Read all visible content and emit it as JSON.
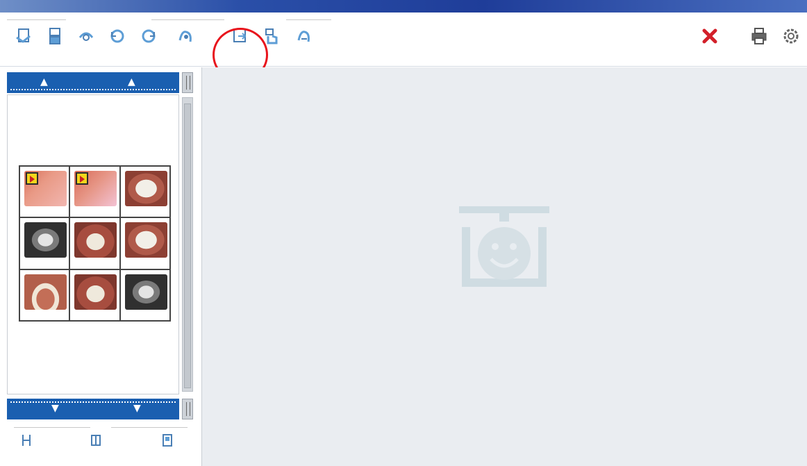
{
  "window": {
    "title": "",
    "controls": ""
  },
  "toolbar": {
    "group1_title": "",
    "group2_title": "",
    "tools": [
      {
        "id": "t1",
        "label": "",
        "icon": "image-edit-icon"
      },
      {
        "id": "t2",
        "label": "",
        "icon": "flip-vertical-icon"
      },
      {
        "id": "t3",
        "label": "",
        "icon": "flip-horizontal-icon"
      },
      {
        "id": "t4",
        "label": "",
        "icon": "rotate-left-icon"
      },
      {
        "id": "t5",
        "label": "",
        "icon": "rotate-right-icon"
      },
      {
        "id": "t6",
        "label": "",
        "icon": "tooth-tool-icon"
      },
      {
        "id": "t7",
        "label": "",
        "icon": "import-image-icon"
      },
      {
        "id": "t8",
        "label": "",
        "icon": "hand-input-icon"
      },
      {
        "id": "t9",
        "label": "",
        "icon": "tooth-manage-icon"
      }
    ],
    "close_label": "",
    "print_label": "",
    "settings_label": ""
  },
  "left_panel": {
    "thumbnails": [
      {
        "kind": "video",
        "caption": ""
      },
      {
        "kind": "video2",
        "caption": ""
      },
      {
        "kind": "teeth",
        "caption": ""
      },
      {
        "kind": "xray",
        "caption": ""
      },
      {
        "kind": "teeth2",
        "caption": ""
      },
      {
        "kind": "teeth",
        "caption": ""
      },
      {
        "kind": "arch",
        "caption": ""
      },
      {
        "kind": "teeth2",
        "caption": ""
      },
      {
        "kind": "xray",
        "caption": ""
      }
    ],
    "bottom_group_title": "",
    "bottom_tools": [
      {
        "label": "",
        "icon": "split-view-icon"
      },
      {
        "label": "",
        "icon": "layout-icon"
      },
      {
        "label": "",
        "icon": "view-icon"
      }
    ]
  },
  "viewer": {
    "watermark_text": ""
  },
  "colors": {
    "accent": "#1a5fb0",
    "highlight": "#e8141c",
    "viewer_bg": "#eaedf1"
  }
}
